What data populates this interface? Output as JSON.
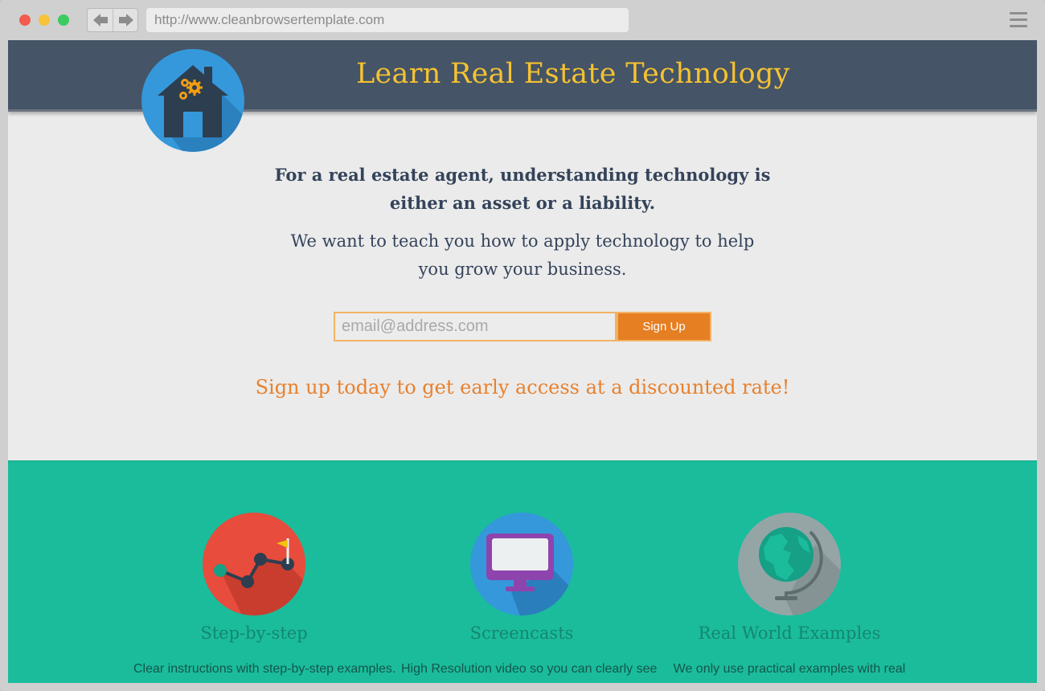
{
  "browser": {
    "url": "http://www.cleanbrowsertemplate.com"
  },
  "header": {
    "title": "Learn Real Estate Technology",
    "logo_icon": "house-gears-icon"
  },
  "hero": {
    "headline_line1": "For a real estate agent, understanding technology is",
    "headline_line2": "either an asset or a liability.",
    "subline_line1": "We want to teach you how to apply technology to help",
    "subline_line2": "you grow your business."
  },
  "signup": {
    "email_placeholder": "email@address.com",
    "email_value": "",
    "button_label": "Sign Up"
  },
  "promo": "Sign up today to get early access at a discounted rate!",
  "features": [
    {
      "icon": "chart-flag-icon",
      "title": "Step-by-step",
      "text": "Clear instructions with step-by-step examples."
    },
    {
      "icon": "monitor-icon",
      "title": "Screencasts",
      "text": "High Resolution video so you can clearly see"
    },
    {
      "icon": "globe-icon",
      "title": "Real World Examples",
      "text": "We only use practical examples with real"
    }
  ],
  "colors": {
    "header_bg": "#455466",
    "title_yellow": "#f5c231",
    "accent_orange": "#e67e22",
    "features_bg": "#1abc9c"
  }
}
